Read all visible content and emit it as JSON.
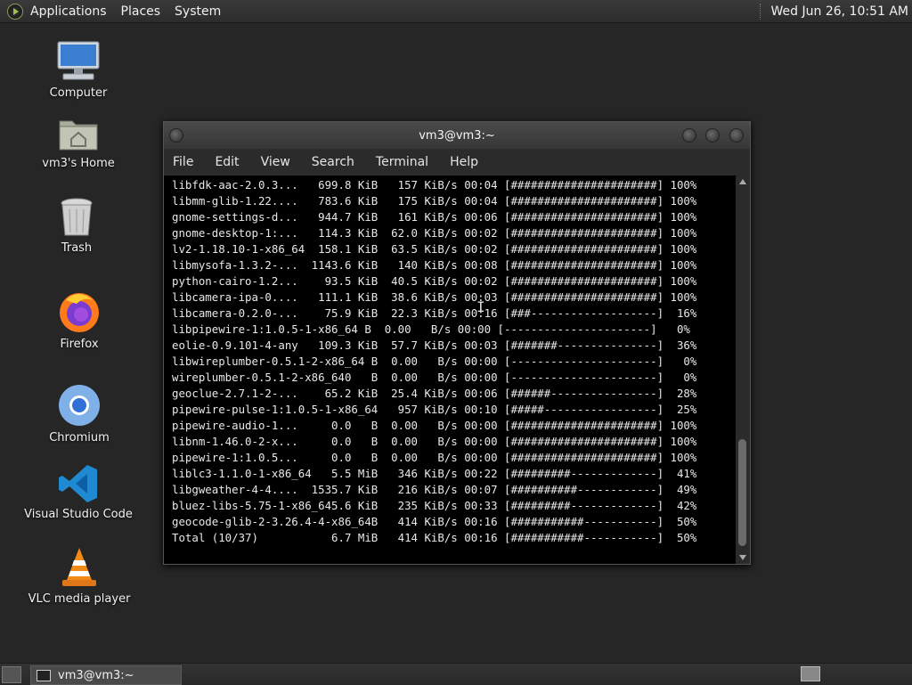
{
  "top_panel": {
    "menus": [
      "Applications",
      "Places",
      "System"
    ],
    "clock": "Wed Jun 26, 10:51 AM"
  },
  "desktop_icons": [
    {
      "label": "Computer",
      "icon": "computer-icon"
    },
    {
      "label": "vm3's Home",
      "icon": "home-folder-icon"
    },
    {
      "label": "Trash",
      "icon": "trash-icon"
    },
    {
      "label": "Firefox",
      "icon": "firefox-icon"
    },
    {
      "label": "Chromium",
      "icon": "chromium-icon"
    },
    {
      "label": "Visual Studio Code",
      "icon": "vscode-icon"
    },
    {
      "label": "VLC media player",
      "icon": "vlc-icon"
    }
  ],
  "terminal": {
    "title": "vm3@vm3:~",
    "menus": [
      "File",
      "Edit",
      "View",
      "Search",
      "Terminal",
      "Help"
    ],
    "lines": [
      "libfdk-aac-2.0.3...   699.8 KiB   157 KiB/s 00:04 [######################] 100%",
      "libmm-glib-1.22....   783.6 KiB   175 KiB/s 00:04 [######################] 100%",
      "gnome-settings-d...   944.7 KiB   161 KiB/s 00:06 [######################] 100%",
      "gnome-desktop-1:...   114.3 KiB  62.0 KiB/s 00:02 [######################] 100%",
      "lv2-1.18.10-1-x86_64  158.1 KiB  63.5 KiB/s 00:02 [######################] 100%",
      "libmysofa-1.3.2-...  1143.6 KiB   140 KiB/s 00:08 [######################] 100%",
      "python-cairo-1.2...    93.5 KiB  40.5 KiB/s 00:02 [######################] 100%",
      "libcamera-ipa-0....   111.1 KiB  38.6 KiB/s 00:03 [######################] 100%",
      "libcamera-0.2.0-...    75.9 KiB  22.3 KiB/s 00:16 [###-------------------]  16%",
      "libpipewire-1:1.0.5-1-x86_64 B  0.00   B/s 00:00 [----------------------]   0%",
      "eolie-0.9.101-4-any   109.3 KiB  57.7 KiB/s 00:03 [#######---------------]  36%",
      "libwireplumber-0.5.1-2-x86_64 B  0.00   B/s 00:00 [----------------------]   0%",
      "wireplumber-0.5.1-2-x86_640   B  0.00   B/s 00:00 [----------------------]   0%",
      "geoclue-2.7.1-2-...    65.2 KiB  25.4 KiB/s 00:06 [######----------------]  28%",
      "pipewire-pulse-1:1.0.5-1-x86_64   957 KiB/s 00:10 [#####-----------------]  25%",
      "pipewire-audio-1...     0.0   B  0.00   B/s 00:00 [######################] 100%",
      "libnm-1.46.0-2-x...     0.0   B  0.00   B/s 00:00 [######################] 100%",
      "pipewire-1:1.0.5...     0.0   B  0.00   B/s 00:00 [######################] 100%",
      "liblc3-1.1.0-1-x86_64   5.5 MiB   346 KiB/s 00:22 [#########-------------]  41%",
      "libgweather-4-4....  1535.7 KiB   216 KiB/s 00:07 [##########------------]  49%",
      "bluez-libs-5.75-1-x86_645.6 KiB   235 KiB/s 00:33 [#########-------------]  42%",
      "geocode-glib-2-3.26.4-4-x86_64B   414 KiB/s 00:16 [###########-----------]  50%",
      "Total (10/37)           6.7 MiB   414 KiB/s 00:16 [###########-----------]  50%"
    ]
  },
  "taskbar": {
    "window_label": "vm3@vm3:~"
  }
}
